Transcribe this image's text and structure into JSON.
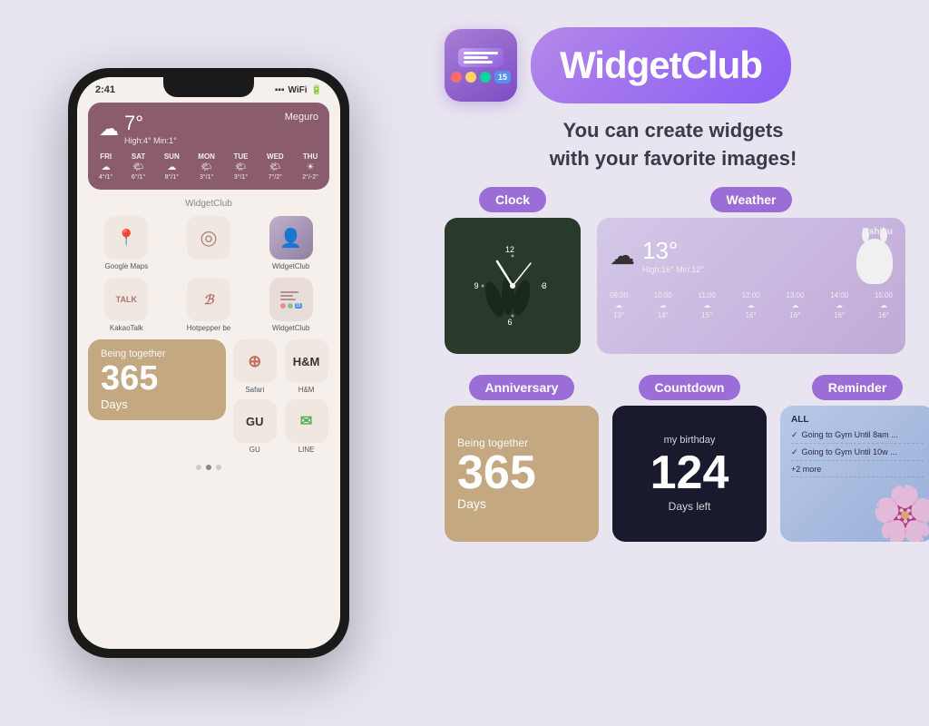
{
  "app": {
    "name": "WidgetClub",
    "tagline_line1": "You can create widgets",
    "tagline_line2": "with your favorite images!",
    "logo_number": "15"
  },
  "phone": {
    "time": "2:41",
    "weather": {
      "temp": "7°",
      "high": "High:4°",
      "min": "Min:1°",
      "location": "Meguro",
      "days": [
        {
          "name": "FRI",
          "icon": "☁",
          "temp": "4°/1°"
        },
        {
          "name": "SAT",
          "icon": "🌤",
          "temp": "6°/1°"
        },
        {
          "name": "SUN",
          "icon": "☁",
          "temp": "8°/1°"
        },
        {
          "name": "MON",
          "icon": "🌤",
          "temp": "3°/1°"
        },
        {
          "name": "TUE",
          "icon": "🌤",
          "temp": "3°/1°"
        },
        {
          "name": "WED",
          "icon": "🌤",
          "temp": "7°/2°"
        },
        {
          "name": "THU",
          "icon": "☀",
          "temp": "2°/-2°"
        }
      ]
    },
    "widgetclub_label": "WidgetClub",
    "apps_row1": [
      {
        "name": "Google Maps",
        "icon": "📍"
      },
      {
        "name": "",
        "icon": ""
      },
      {
        "name": "WidgetClub",
        "icon": ""
      }
    ],
    "apps_row2": [
      {
        "name": "KakaoTalk",
        "icon": "TALK"
      },
      {
        "name": "Hotpepper be",
        "icon": "ℬ"
      },
      {
        "name": "WidgetClub",
        "icon": ""
      }
    ],
    "anniversary": {
      "being_together": "Being together",
      "number": "365",
      "days": "Days"
    },
    "bottom_apps": [
      {
        "name": "Safari",
        "icon": "⊕"
      },
      {
        "name": "H&M",
        "icon": "H&M"
      },
      {
        "name": "GU",
        "icon": "GU"
      },
      {
        "name": "LINE",
        "icon": "✉"
      }
    ]
  },
  "widgets": {
    "clock": {
      "label": "Clock",
      "time_12": "12",
      "time_3": "3",
      "time_6": "6",
      "time_9": "9"
    },
    "weather": {
      "label": "Weather",
      "temp": "13°",
      "high": "High:16°",
      "min": "Min:12°",
      "location": "Ushiku",
      "times": [
        "09:00",
        "10:00",
        "11:00",
        "12:00",
        "13:00",
        "14:00",
        "15:00"
      ],
      "temps": [
        "13°",
        "14°",
        "15°",
        "16°",
        "16°",
        "16°",
        "16°"
      ]
    },
    "anniversary": {
      "label": "Anniversary",
      "being_together": "Being together",
      "number": "365",
      "days": "Days"
    },
    "countdown": {
      "label": "Countdown",
      "title": "my birthday",
      "number": "124",
      "sub": "Days left"
    },
    "reminder": {
      "label": "Reminder",
      "label_all": "ALL",
      "items": [
        "Going to Gym Until 8am ...",
        "Going to Gym Until 10w ...",
        "+2 more"
      ]
    }
  }
}
